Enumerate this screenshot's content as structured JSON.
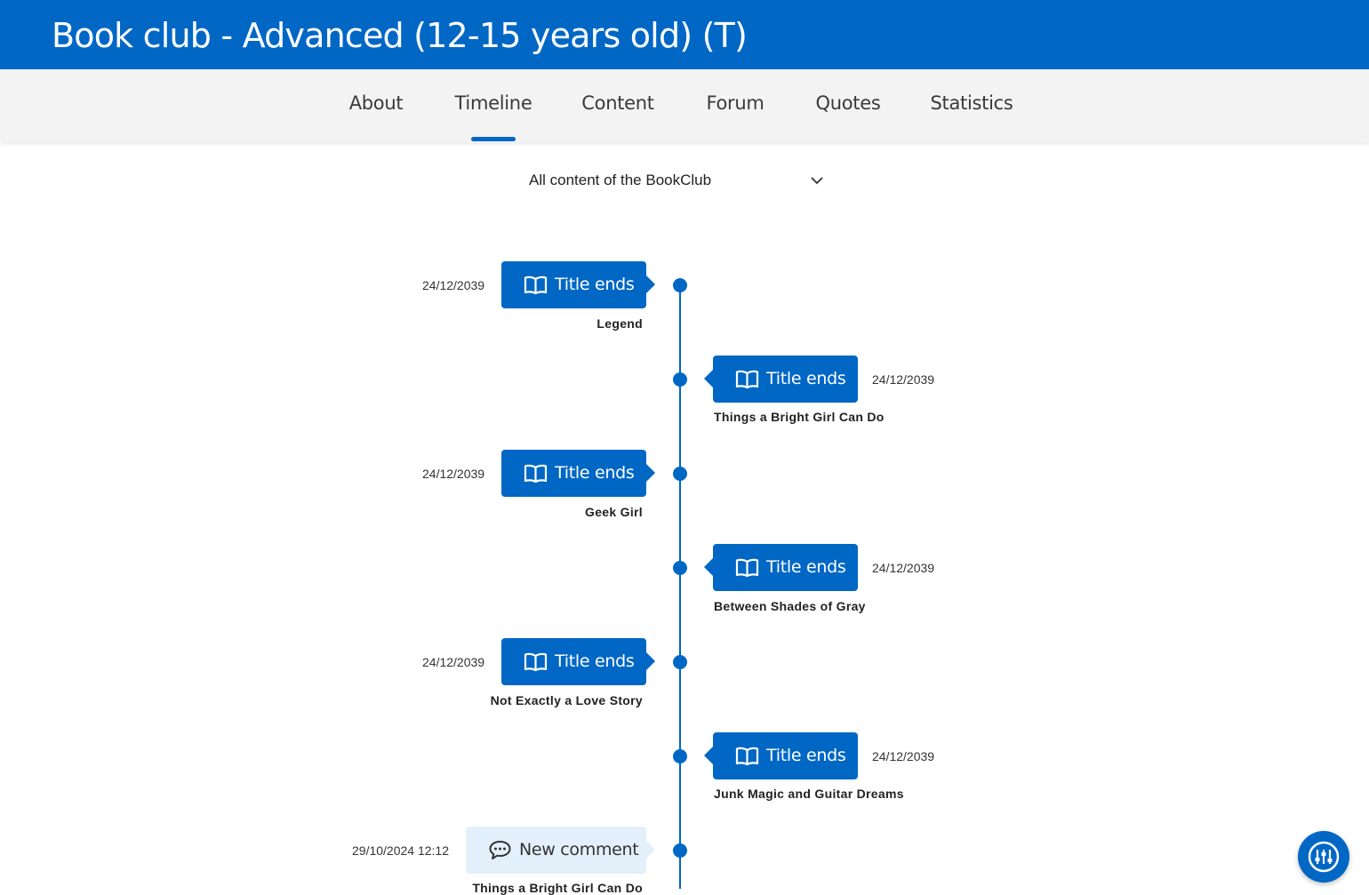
{
  "header": {
    "title": "Book club - Advanced (12-15 years old) (T)"
  },
  "tabs": [
    {
      "label": "About"
    },
    {
      "label": "Timeline",
      "active": true
    },
    {
      "label": "Content"
    },
    {
      "label": "Forum"
    },
    {
      "label": "Quotes"
    },
    {
      "label": "Statistics"
    }
  ],
  "filter": {
    "selected": "All content of the BookClub",
    "icon": "chevron-down-icon"
  },
  "timeline": {
    "events": [
      {
        "side": "left",
        "type": "title-end",
        "icon": "book-icon",
        "label": "Title ends",
        "date": "24/12/2039",
        "title": "Legend"
      },
      {
        "side": "right",
        "type": "title-end",
        "icon": "book-icon",
        "label": "Title ends",
        "date": "24/12/2039",
        "title": "Things a Bright Girl Can Do"
      },
      {
        "side": "left",
        "type": "title-end",
        "icon": "book-icon",
        "label": "Title ends",
        "date": "24/12/2039",
        "title": "Geek Girl"
      },
      {
        "side": "right",
        "type": "title-end",
        "icon": "book-icon",
        "label": "Title ends",
        "date": "24/12/2039",
        "title": "Between Shades of Gray"
      },
      {
        "side": "left",
        "type": "title-end",
        "icon": "book-icon",
        "label": "Title ends",
        "date": "24/12/2039",
        "title": "Not Exactly a Love Story"
      },
      {
        "side": "right",
        "type": "title-end",
        "icon": "book-icon",
        "label": "Title ends",
        "date": "24/12/2039",
        "title": "Junk Magic and Guitar Dreams"
      },
      {
        "side": "left",
        "type": "comment",
        "icon": "comment-icon",
        "label": "New comment",
        "date": "29/10/2024 12:12",
        "title": "Things a Bright Girl Can Do"
      }
    ]
  },
  "fab": {
    "icon": "settings-sliders-icon"
  },
  "colors": {
    "primary": "#0067c5",
    "comment_bg": "#e3f0fb"
  }
}
